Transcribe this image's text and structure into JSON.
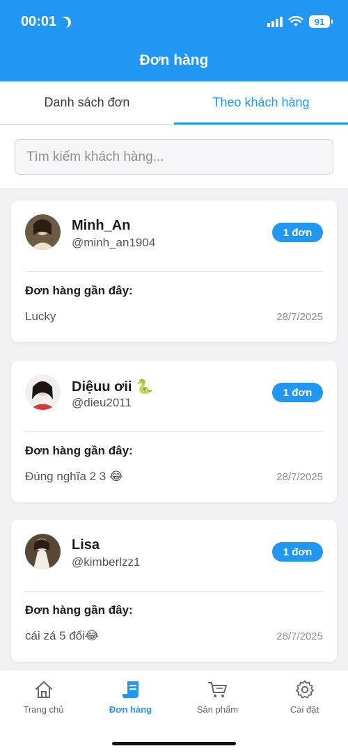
{
  "status_bar": {
    "time": "00:01",
    "battery": "91"
  },
  "header": {
    "title": "Đơn hàng"
  },
  "tabs": [
    {
      "label": "Danh sách đơn",
      "active": false
    },
    {
      "label": "Theo khách hàng",
      "active": true
    }
  ],
  "search": {
    "placeholder": "Tìm kiếm khách hàng..."
  },
  "customers": [
    {
      "name": "Minh_An",
      "handle": "@minh_an1904",
      "badge": "1 đơn",
      "recent_label": "Đơn hàng gần đây:",
      "recent_text": "Lucky",
      "recent_date": "28/7/2025"
    },
    {
      "name": "Diệuu ơii 🐍",
      "handle": "@dieu2011",
      "badge": "1 đơn",
      "recent_label": "Đơn hàng gần đây:",
      "recent_text": "Đúng nghĩa 2 3 😂",
      "recent_date": "28/7/2025"
    },
    {
      "name": "Lisa",
      "handle": "@kimberlzz1",
      "badge": "1 đơn",
      "recent_label": "Đơn hàng gần đây:",
      "recent_text": "cái zá 5 đổi😂",
      "recent_date": "28/7/2025"
    }
  ],
  "bottom_nav": [
    {
      "label": "Trang chủ",
      "icon": "home-icon",
      "active": false
    },
    {
      "label": "Đơn hàng",
      "icon": "receipt-icon",
      "active": true
    },
    {
      "label": "Sản phẩm",
      "icon": "cart-icon",
      "active": false
    },
    {
      "label": "Cài đặt",
      "icon": "gear-icon",
      "active": false
    }
  ],
  "colors": {
    "accent": "#2196f3"
  }
}
